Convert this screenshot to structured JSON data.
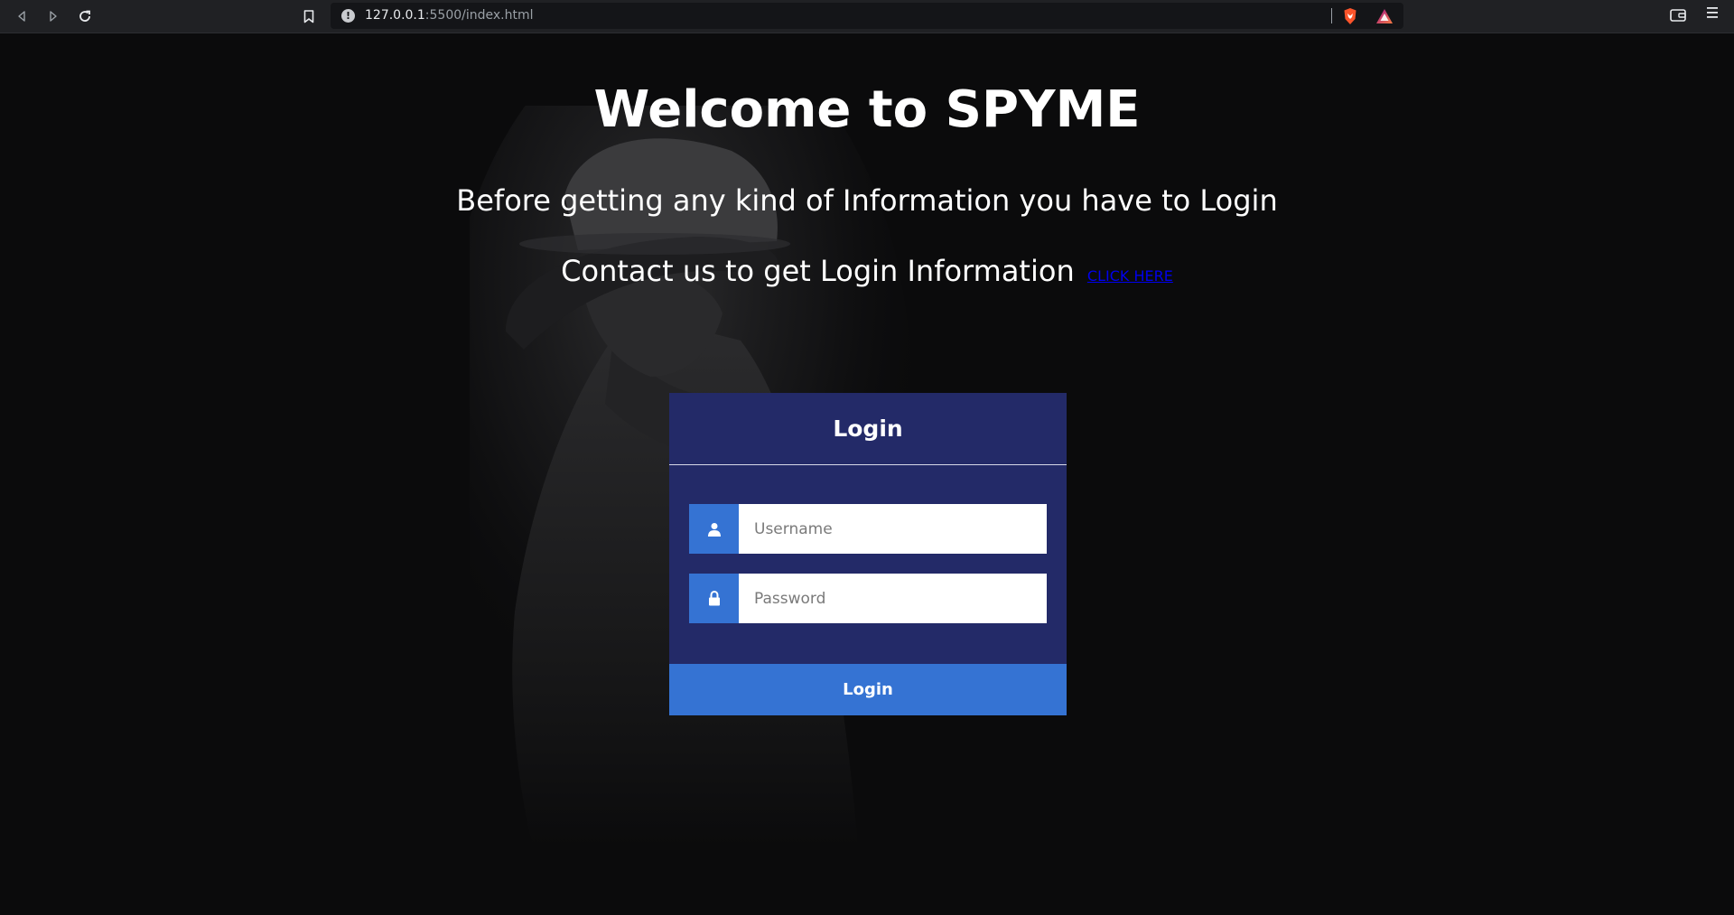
{
  "browser": {
    "url_host": "127.0.0.1",
    "url_path": ":5500/index.html",
    "icons": {
      "back": "back-arrow-icon",
      "forward": "forward-arrow-icon",
      "reload": "reload-icon",
      "bookmark": "bookmark-icon",
      "site_info": "info-icon",
      "shield": "brave-shield-icon",
      "rewards": "brave-rewards-icon",
      "wallet": "wallet-icon",
      "menu": "menu-icon"
    },
    "colors": {
      "shield": "#fb542b",
      "rewards_a": "#a1148c",
      "rewards_b": "#f57a42"
    }
  },
  "page": {
    "title": "Welcome to SPYME",
    "subtitle": "Before getting any kind of Information you have to Login",
    "contact_text": "Contact us to get Login Information",
    "contact_link": "CLICK HERE"
  },
  "login": {
    "header": "Login",
    "username_placeholder": "Username",
    "password_placeholder": "Password",
    "submit_label": "Login",
    "icons": {
      "username": "user-icon",
      "password": "lock-icon"
    }
  },
  "colors": {
    "background": "#0b0b0c",
    "card": "#232a68",
    "accent": "#3573d3",
    "link": "#0000ee",
    "text": "#ffffff"
  }
}
